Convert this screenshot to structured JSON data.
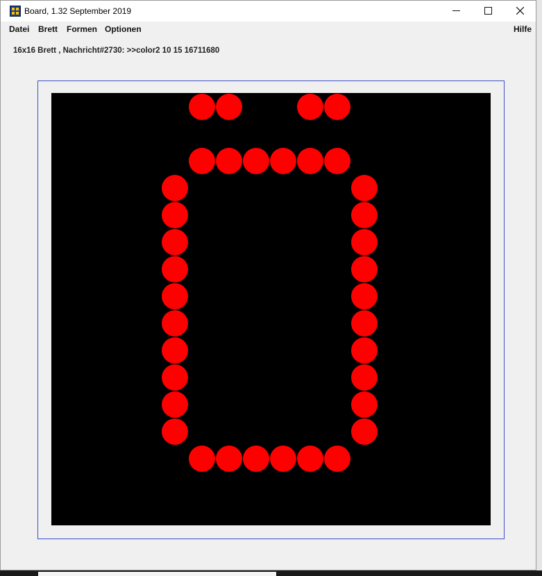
{
  "window": {
    "title": "Board, 1.32   September 2019",
    "minimize_glyph": "—",
    "maximize_glyph": "☐",
    "close_glyph": "✕"
  },
  "menu": {
    "items": [
      "Datei",
      "Brett",
      "Formen",
      "Optionen"
    ],
    "help": "Hilfe"
  },
  "status": {
    "text": "16x16 Brett , Nachricht#2730: >>color2 10 15 16711680"
  },
  "board": {
    "size": 16,
    "background_color": "#000000",
    "dot_color": "#ff0000",
    "frame_color": "#3f4fc7",
    "dots": [
      [
        0,
        5
      ],
      [
        0,
        6
      ],
      [
        0,
        9
      ],
      [
        0,
        10
      ],
      [
        2,
        5
      ],
      [
        2,
        6
      ],
      [
        2,
        7
      ],
      [
        2,
        8
      ],
      [
        2,
        9
      ],
      [
        2,
        10
      ],
      [
        3,
        4
      ],
      [
        3,
        11
      ],
      [
        4,
        4
      ],
      [
        4,
        11
      ],
      [
        5,
        4
      ],
      [
        5,
        11
      ],
      [
        6,
        4
      ],
      [
        6,
        11
      ],
      [
        7,
        4
      ],
      [
        7,
        11
      ],
      [
        8,
        4
      ],
      [
        8,
        11
      ],
      [
        9,
        4
      ],
      [
        9,
        11
      ],
      [
        10,
        4
      ],
      [
        10,
        11
      ],
      [
        11,
        4
      ],
      [
        11,
        11
      ],
      [
        12,
        4
      ],
      [
        12,
        11
      ],
      [
        13,
        5
      ],
      [
        13,
        6
      ],
      [
        13,
        7
      ],
      [
        13,
        8
      ],
      [
        13,
        9
      ],
      [
        13,
        10
      ]
    ]
  }
}
